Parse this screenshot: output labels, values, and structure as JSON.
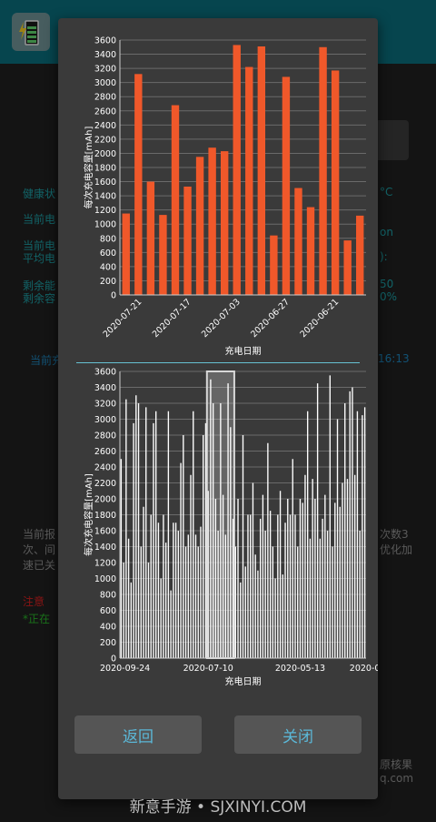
{
  "dialog": {
    "back_label": "返回",
    "close_label": "关闭"
  },
  "watermark": "新意手游 • SJXINYI.COM",
  "background": {
    "texts": [
      {
        "text": "健康状",
        "x": 25,
        "y": 214,
        "color": "#1d9aa0"
      },
      {
        "text": "当前电",
        "x": 25,
        "y": 242,
        "color": "#1d9aa0"
      },
      {
        "text": "当前电",
        "x": 25,
        "y": 271,
        "color": "#1d9aa0"
      },
      {
        "text": "平均电",
        "x": 25,
        "y": 285,
        "color": "#1d9aa0"
      },
      {
        "text": "剩余能",
        "x": 25,
        "y": 315,
        "color": "#1d9aa0"
      },
      {
        "text": "剩余容",
        "x": 25,
        "y": 329,
        "color": "#1d9aa0"
      },
      {
        "text": "当前充",
        "x": 33,
        "y": 397,
        "color": "#1d7fb4"
      },
      {
        "text": "当前报",
        "x": 25,
        "y": 588,
        "color": "#8b8b8b"
      },
      {
        "text": "次、间",
        "x": 25,
        "y": 605,
        "color": "#8b8b8b"
      },
      {
        "text": "速已关",
        "x": 25,
        "y": 622,
        "color": "#8b8b8b"
      },
      {
        "text": "注意",
        "x": 25,
        "y": 662,
        "color": "#d31f1f"
      },
      {
        "text": "*正在",
        "x": 25,
        "y": 681,
        "color": "#28b028"
      },
      {
        "text": "°C",
        "x": 418,
        "y": 214,
        "color": "#1d9aa0"
      },
      {
        "text": "on",
        "x": 418,
        "y": 258,
        "color": "#1d9aa0"
      },
      {
        "text": "):",
        "x": 418,
        "y": 285,
        "color": "#1d9aa0"
      },
      {
        "text": "50",
        "x": 418,
        "y": 315,
        "color": "#1d9aa0"
      },
      {
        "text": "0%",
        "x": 418,
        "y": 329,
        "color": "#1d9aa0"
      },
      {
        "text": "16:13",
        "x": 416,
        "y": 397,
        "color": "#1d7fb4"
      },
      {
        "text": "次数3",
        "x": 418,
        "y": 588,
        "color": "#8b8b8b"
      },
      {
        "text": "优化加",
        "x": 418,
        "y": 605,
        "color": "#8b8b8b"
      },
      {
        "text": "原核果",
        "x": 418,
        "y": 841,
        "color": "#8b8b8b"
      },
      {
        "text": "q.com",
        "x": 418,
        "y": 858,
        "color": "#8b8b8b"
      }
    ]
  },
  "chart_data": [
    {
      "type": "bar",
      "ylabel": "每次充电容量[mAh]",
      "xlabel": "充电日期",
      "ylim": [
        0,
        3600
      ],
      "yticks": [
        0,
        200,
        400,
        600,
        800,
        1000,
        1200,
        1400,
        1600,
        1800,
        2000,
        2200,
        2400,
        2600,
        2800,
        3000,
        3200,
        3400,
        3600
      ],
      "ytick_labels": [
        "0",
        "200",
        "400",
        "600",
        "800",
        "1000",
        "1200",
        "1400",
        "1600",
        "1800",
        "2000",
        "2200",
        "2400",
        "2600",
        "2800",
        "3000",
        "3200",
        "3400",
        "3600"
      ],
      "values": [
        1150,
        3120,
        1600,
        1130,
        2680,
        1530,
        1950,
        2080,
        2030,
        3530,
        3220,
        3510,
        840,
        3080,
        1510,
        1240,
        3500,
        3170,
        770,
        1120
      ],
      "xtick_labels": [
        {
          "index": 1,
          "text": "2020-07-21"
        },
        {
          "index": 5,
          "text": "2020-07-17"
        },
        {
          "index": 9,
          "text": "2020-07-03"
        },
        {
          "index": 13,
          "text": "2020-06-27"
        },
        {
          "index": 17,
          "text": "2020-06-21"
        }
      ],
      "bar_color": "#f0582a",
      "grid": true
    },
    {
      "type": "bar",
      "ylabel": "每次充电容量[mAh]",
      "xlabel": "充电日期",
      "ylim": [
        0,
        3600
      ],
      "yticks": [
        0,
        200,
        400,
        600,
        800,
        1000,
        1200,
        1400,
        1600,
        1800,
        2000,
        2200,
        2400,
        2600,
        2800,
        3000,
        3200,
        3400,
        3600
      ],
      "ytick_labels": [
        "0",
        "200",
        "400",
        "600",
        "800",
        "1000",
        "1200",
        "1400",
        "1600",
        "1800",
        "2000",
        "2200",
        "2400",
        "2600",
        "2800",
        "3000",
        "3200",
        "3400",
        "3600"
      ],
      "xtick_labels": [
        {
          "index": 0,
          "text": "2020-09-24"
        },
        {
          "index": 35,
          "text": "2020-07-10"
        },
        {
          "index": 72,
          "text": "2020-05-13"
        },
        {
          "index": 98,
          "text": "2020-0"
        }
      ],
      "values": [
        2500,
        1200,
        3250,
        1500,
        950,
        2950,
        3300,
        3200,
        1400,
        1900,
        3150,
        1200,
        1800,
        2950,
        3100,
        1700,
        1000,
        1800,
        1450,
        3100,
        850,
        1700,
        1700,
        1600,
        2450,
        2800,
        1400,
        1550,
        2300,
        3100,
        1550,
        1400,
        1650,
        2800,
        2950,
        2100,
        3500,
        3200,
        2000,
        1600,
        3200,
        2050,
        1550,
        3450,
        2900,
        1750,
        1400,
        2000,
        950,
        2800,
        1150,
        1800,
        1800,
        2200,
        1300,
        1100,
        1750,
        2050,
        1600,
        2700,
        1850,
        1400,
        1000,
        1800,
        2100,
        1050,
        1700,
        2000,
        1800,
        2500,
        1800,
        1400,
        2000,
        1950,
        2300,
        3100,
        1500,
        2250,
        2000,
        3450,
        1500,
        1750,
        2050,
        1600,
        3550,
        1400,
        1950,
        3000,
        1900,
        2200,
        3200,
        2250,
        3350,
        3400,
        2300,
        3100,
        1600,
        3050,
        3150
      ],
      "selection": {
        "from_index": 35,
        "to_index": 45
      },
      "bar_color": "#ffffff",
      "grid": true
    }
  ]
}
